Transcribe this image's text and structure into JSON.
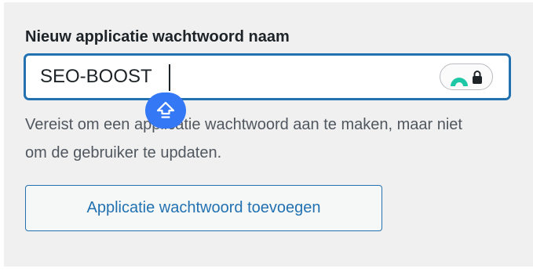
{
  "form": {
    "field_label": "Nieuw applicatie wachtwoord naam",
    "input_value": "SEO-BOOST",
    "description": "Vereist om een applicatie wachtwoord aan te maken, maar niet om de gebruiker te updaten.",
    "add_button_label": "Applicatie wachtwoord toevoegen"
  },
  "icons": {
    "password_manager": "password-manager-logo-icon",
    "lock": "lock-icon",
    "caps_lock": "caps-lock-icon"
  },
  "colors": {
    "accent": "#2271b1",
    "panel_background": "#f0f0f1",
    "manager_logo": "#1ec7a5",
    "caps_bubble": "#3478f6"
  }
}
